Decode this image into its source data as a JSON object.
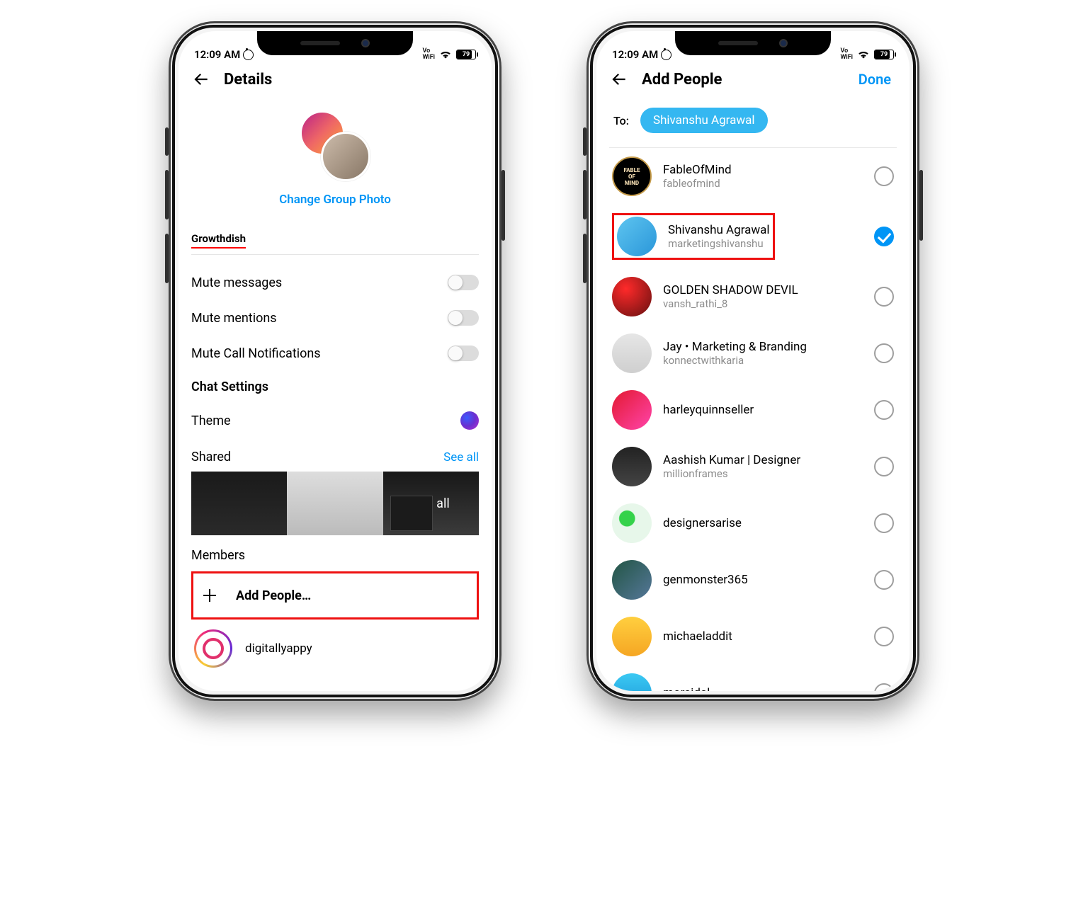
{
  "statusbar": {
    "time": "12:09 AM",
    "carrier_top": "Vo",
    "carrier_bottom": "WiFi",
    "battery_pct": "79"
  },
  "details": {
    "title": "Details",
    "change_photo": "Change Group Photo",
    "group_name": "Growthdish",
    "mute_messages": "Mute messages",
    "mute_mentions": "Mute mentions",
    "mute_calls": "Mute Call Notifications",
    "chat_settings": "Chat Settings",
    "theme_label": "Theme",
    "shared_label": "Shared",
    "see_all": "See all",
    "see_all_overlay": "See all",
    "members_label": "Members",
    "add_people": "Add People…",
    "member1_name": "digitallyappy"
  },
  "addpeople": {
    "title": "Add People",
    "done": "Done",
    "to_label": "To:",
    "chip": "Shivanshu Agrawal",
    "list": [
      {
        "display": "FableOfMind",
        "username": "fableofmind",
        "avatar": "a-fab",
        "checked": false,
        "highlight": false
      },
      {
        "display": "Shivanshu Agrawal",
        "username": "marketingshivanshu",
        "avatar": "a-blue",
        "checked": true,
        "highlight": true
      },
      {
        "display": "GOLDEN SHADOW DEVIL",
        "username": "vansh_rathi_8",
        "avatar": "a-red",
        "checked": false,
        "highlight": false
      },
      {
        "display": "Jay • Marketing & Branding",
        "username": "konnectwithkaria",
        "avatar": "a-gray",
        "checked": false,
        "highlight": false
      },
      {
        "display": "harleyquinnseller",
        "username": "",
        "avatar": "a-red2",
        "checked": false,
        "highlight": false
      },
      {
        "display": "Aashish Kumar | Designer",
        "username": "millionframes",
        "avatar": "a-dark",
        "checked": false,
        "highlight": false
      },
      {
        "display": "designersarise",
        "username": "",
        "avatar": "a-green",
        "checked": false,
        "highlight": false
      },
      {
        "display": "genmonster365",
        "username": "",
        "avatar": "a-nav",
        "checked": false,
        "highlight": false
      },
      {
        "display": "michaeladdit",
        "username": "",
        "avatar": "a-yel",
        "checked": false,
        "highlight": false
      },
      {
        "display": "morajdal",
        "username": "",
        "avatar": "a-cyan",
        "checked": false,
        "highlight": false
      }
    ]
  }
}
